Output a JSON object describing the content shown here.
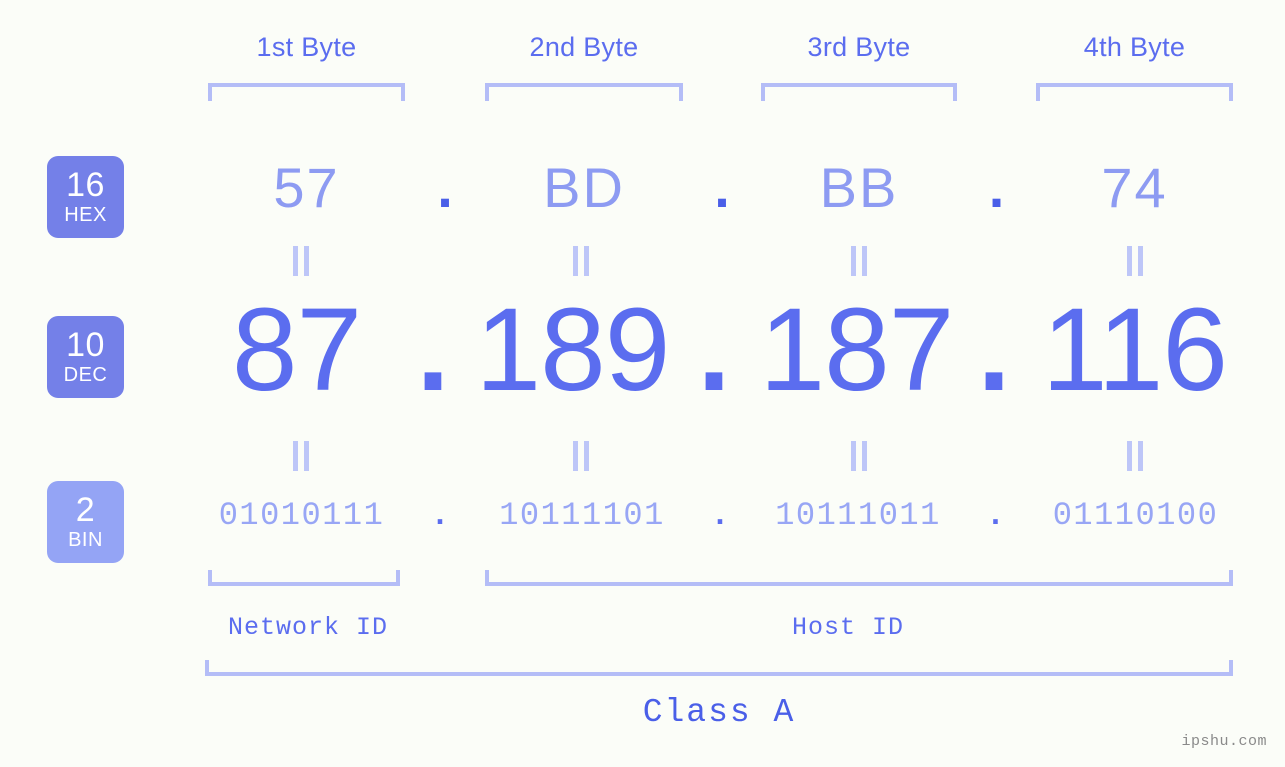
{
  "meta": {
    "background_color": "#fbfdf8",
    "accent_color": "#5b6def",
    "accent_light_color": "#b4bdf7",
    "badge_color": "#7480e8",
    "badge_light_color": "#94a4f5"
  },
  "headers": [
    {
      "label": "1st Byte"
    },
    {
      "label": "2nd Byte"
    },
    {
      "label": "3rd Byte"
    },
    {
      "label": "4th Byte"
    }
  ],
  "bases": [
    {
      "number": "16",
      "name": "HEX"
    },
    {
      "number": "10",
      "name": "DEC"
    },
    {
      "number": "2",
      "name": "BIN"
    }
  ],
  "rows": {
    "hex": {
      "base_number": "16",
      "base_name": "HEX",
      "values": [
        "57",
        "BD",
        "BB",
        "74"
      ],
      "separator": "."
    },
    "dec": {
      "base_number": "10",
      "base_name": "DEC",
      "values": [
        "87",
        "189",
        "187",
        "116"
      ],
      "separator": "."
    },
    "bin": {
      "base_number": "2",
      "base_name": "BIN",
      "values": [
        "01010111",
        "10111101",
        "10111011",
        "01110100"
      ],
      "separator": "."
    }
  },
  "equals_marks": {
    "glyph": "||",
    "count_per_row": 4
  },
  "segments": {
    "network_id": "Network ID",
    "host_id": "Host ID",
    "ip_class": "Class A"
  },
  "watermark": "ipshu.com"
}
